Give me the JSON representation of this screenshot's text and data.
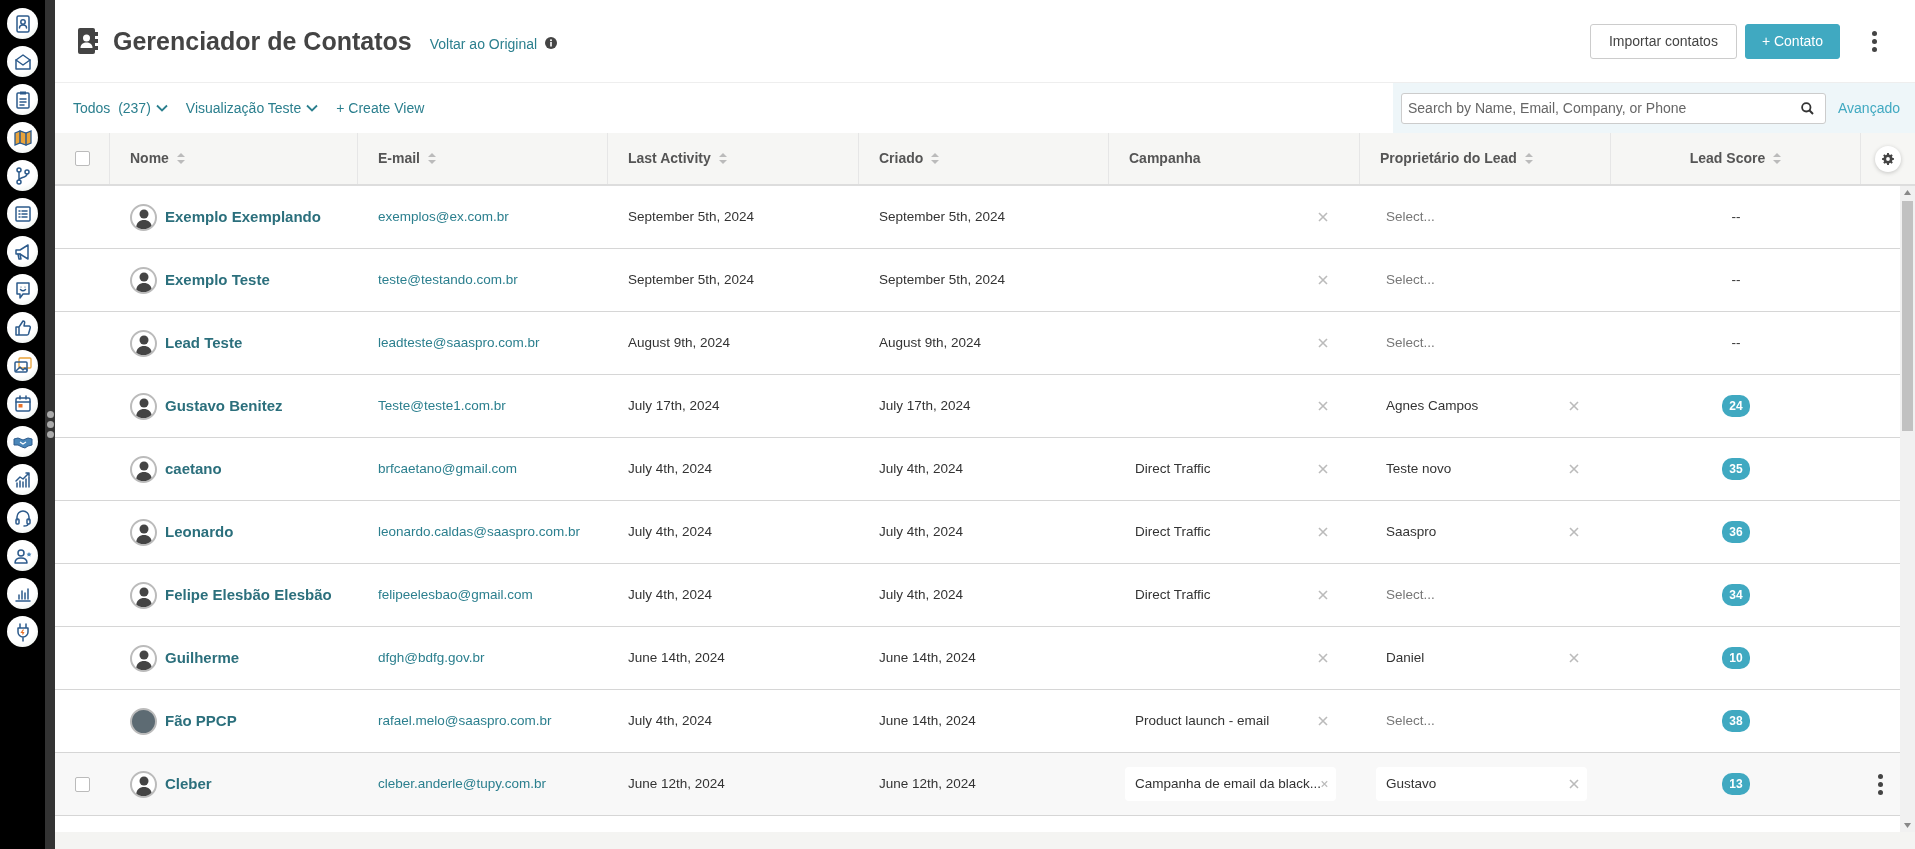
{
  "header": {
    "title": "Gerenciador de Contatos",
    "back_link": "Voltar ao Original",
    "buttons": [
      {
        "label": "Importar contatos",
        "kind": "outline"
      },
      {
        "label": "+ Contato",
        "kind": "primary"
      }
    ]
  },
  "toolbar": {
    "views": [
      {
        "label": "Todos",
        "count": "(237)",
        "dropdown": true
      },
      {
        "label": "Visualização Teste",
        "dropdown": true
      },
      {
        "label": "+ Create View",
        "dropdown": false
      }
    ],
    "search": {
      "placeholder": "Search by Name, Email, Company, or Phone"
    },
    "advanced_link": "Avançado"
  },
  "table": {
    "select_all": {
      "checked": false
    },
    "columns": [
      {
        "label": "Nome",
        "sortable": true
      },
      {
        "label": "E-mail",
        "sortable": true
      },
      {
        "label": "Last Activity",
        "sortable": true
      },
      {
        "label": "Criado",
        "sortable": true
      },
      {
        "label": "Campanha",
        "sortable": false
      },
      {
        "label": "Proprietário do Lead",
        "sortable": true
      },
      {
        "label": "Lead Score",
        "sortable": true
      }
    ],
    "rows": [
      {
        "photo": false,
        "name": "Exemplo Exemplando",
        "email": "exemplos@ex.com.br",
        "last_activity": "September 5th, 2024",
        "created": "September 5th, 2024",
        "owner_placeholder": "Select...",
        "lead_score": "--",
        "badge": false,
        "hovered": false
      },
      {
        "photo": false,
        "name": "Exemplo Teste",
        "email": "teste@testando.com.br",
        "last_activity": "September 5th, 2024",
        "created": "September 5th, 2024",
        "owner_placeholder": "Select...",
        "lead_score": "--",
        "badge": false,
        "hovered": false
      },
      {
        "photo": false,
        "name": "Lead Teste",
        "email": "leadteste@saaspro.com.br",
        "last_activity": "August 9th, 2024",
        "created": "August 9th, 2024",
        "owner_placeholder": "Select...",
        "lead_score": "--",
        "badge": false,
        "hovered": false
      },
      {
        "photo": false,
        "name": "Gustavo Benitez",
        "email": "Teste@teste1.com.br",
        "last_activity": "July 17th, 2024",
        "created": "July 17th, 2024",
        "owner": "Agnes Campos",
        "lead_score": "24",
        "badge": true,
        "hovered": false
      },
      {
        "photo": false,
        "name": "caetano",
        "email": "brfcaetano@gmail.com",
        "last_activity": "July 4th, 2024",
        "created": "July 4th, 2024",
        "campaign": "Direct Traffic",
        "owner": "Teste novo",
        "lead_score": "35",
        "badge": true,
        "hovered": false
      },
      {
        "photo": false,
        "name": "Leonardo",
        "email": "leonardo.caldas@saaspro.com.br",
        "last_activity": "July 4th, 2024",
        "created": "July 4th, 2024",
        "campaign": "Direct Traffic",
        "owner": "Saaspro",
        "lead_score": "36",
        "badge": true,
        "hovered": false
      },
      {
        "photo": false,
        "name": "Felipe Elesbão Elesbão",
        "email": "felipeelesbao@gmail.com",
        "last_activity": "July 4th, 2024",
        "created": "July 4th, 2024",
        "campaign": "Direct Traffic",
        "owner_placeholder": "Select...",
        "lead_score": "34",
        "badge": true,
        "hovered": false
      },
      {
        "photo": false,
        "name": "Guilherme",
        "email": "dfgh@bdfg.gov.br",
        "last_activity": "June 14th, 2024",
        "created": "June 14th, 2024",
        "owner": "Daniel",
        "lead_score": "10",
        "badge": true,
        "hovered": false
      },
      {
        "photo": true,
        "name": "Fão PPCP",
        "email": "rafael.melo@saaspro.com.br",
        "last_activity": "July 4th, 2024",
        "created": "June 14th, 2024",
        "campaign": "Product launch - email",
        "owner_placeholder": "Select...",
        "lead_score": "38",
        "badge": true,
        "hovered": false
      },
      {
        "photo": false,
        "name": "Cleber",
        "email": "cleber.anderle@tupy.com.br",
        "last_activity": "June 12th, 2024",
        "created": "June 12th, 2024",
        "campaign": "Campanha de email da black...",
        "owner": "Gustavo",
        "lead_score": "13",
        "badge": true,
        "hovered": true,
        "checked": false
      }
    ]
  }
}
